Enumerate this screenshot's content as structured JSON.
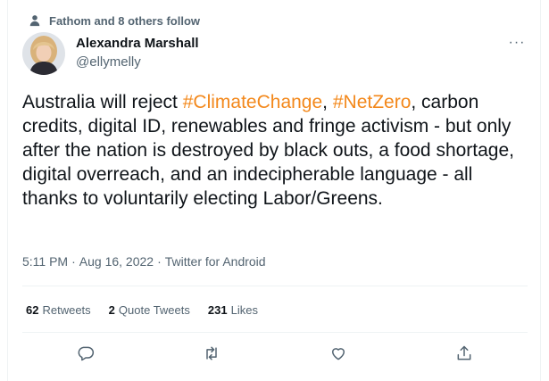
{
  "social_context": {
    "text": "Fathom and 8 others follow",
    "icon": "person-icon"
  },
  "author": {
    "name": "Alexandra Marshall",
    "handle": "@ellymelly"
  },
  "more_label": "···",
  "tweet": {
    "segments": [
      {
        "text": "Australia will reject ",
        "type": "text"
      },
      {
        "text": "#ClimateChange",
        "type": "hashtag"
      },
      {
        "text": ", ",
        "type": "text"
      },
      {
        "text": "#NetZero",
        "type": "hashtag"
      },
      {
        "text": ", carbon credits, digital ID, renewables and fringe activism - but only after the nation is destroyed by black outs, a food shortage, digital overreach, and an indecipherable language - all thanks to voluntarily electing Labor/Greens.",
        "type": "text"
      }
    ]
  },
  "meta": {
    "time": "5:11 PM",
    "sep1": "·",
    "date": "Aug 16, 2022",
    "sep2": "·",
    "source": "Twitter for Android"
  },
  "stats": {
    "retweets": {
      "count": "62",
      "label": "Retweets"
    },
    "quotes": {
      "count": "2",
      "label": "Quote Tweets"
    },
    "likes": {
      "count": "231",
      "label": "Likes"
    }
  },
  "actions": [
    "reply-icon",
    "retweet-icon",
    "like-icon",
    "share-icon"
  ],
  "colors": {
    "hashtag": "#f3881b",
    "secondary_text": "#536471",
    "divider": "#eff3f4"
  }
}
